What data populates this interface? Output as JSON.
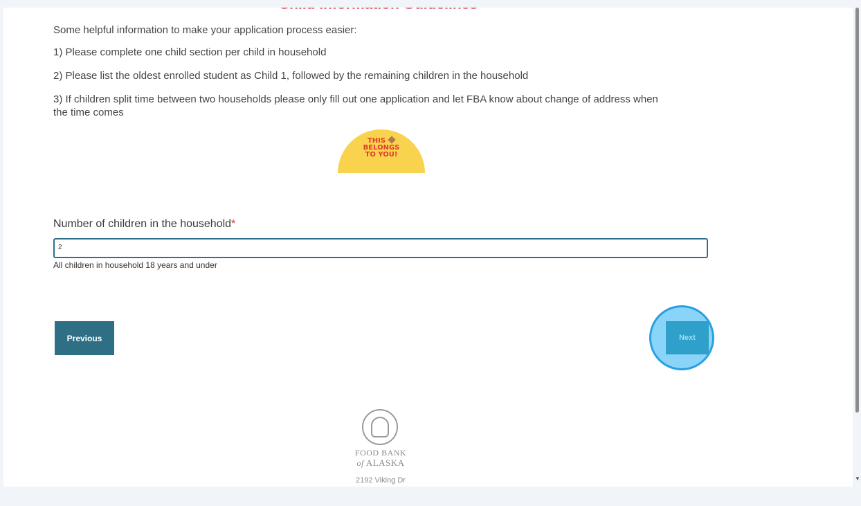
{
  "section": {
    "heading": "Child Information Guidelines",
    "intro": "Some helpful information to make your application process easier:",
    "guidelines": [
      "1) Please complete one child section per child in household",
      "2) Please list the oldest enrolled student as Child 1, followed by the remaining children in the household",
      "3) If children split time between two households please only fill out one application and let FBA know about change of address when",
      "the time comes"
    ]
  },
  "sticker": {
    "lines": [
      "THIS",
      "BELONGS",
      "TO YOU!"
    ]
  },
  "form": {
    "children_label": "Number of children in the household",
    "required_mark": "*",
    "children_value": "2",
    "children_help": "All children in household 18 years and under"
  },
  "nav": {
    "previous_label": "Previous",
    "next_label": "Next"
  },
  "footer": {
    "logo_line1": "FOOD BANK",
    "logo_line2_prefix": "of",
    "logo_line2": "ALASKA",
    "address": "2192 Viking Dr"
  },
  "colors": {
    "primary_button": "#2f6f86",
    "focus_ring": "#27a0e0",
    "sticker": "#f9d34d"
  }
}
